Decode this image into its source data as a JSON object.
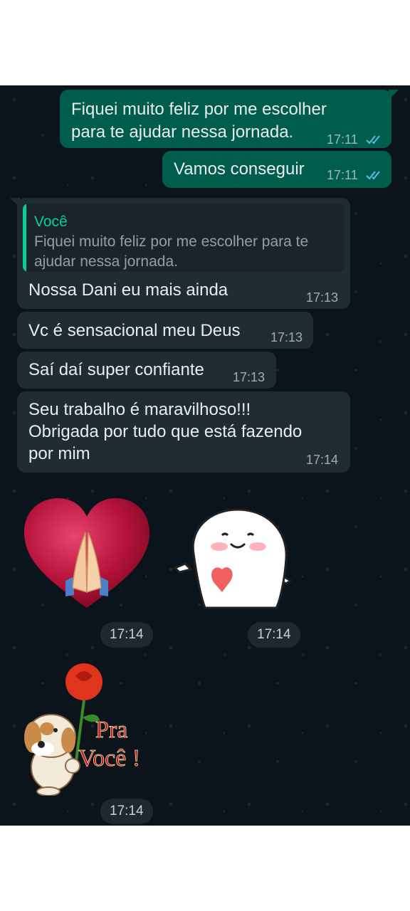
{
  "messages": [
    {
      "text_lines": [
        "Fiquei muito feliz por me escolher",
        "para te ajudar nessa jornada."
      ],
      "time": "17:11"
    },
    {
      "text": "Vamos conseguir",
      "time": "17:11"
    },
    {
      "quote_author": "Você",
      "quote_text": "Fiquei muito feliz por me escolher para te ajudar nessa jornada.",
      "text": "Nossa Dani eu mais ainda",
      "time": "17:13"
    },
    {
      "text": "Vc é sensacional meu Deus",
      "time": "17:13"
    },
    {
      "text": "Saí daí super confiante",
      "time": "17:13"
    },
    {
      "text_lines": [
        "Seu trabalho é maravilhoso!!!",
        "Obrigada por tudo que está fazendo",
        "por mim"
      ],
      "time": "17:14"
    }
  ],
  "stickers": [
    {
      "icon": "heart-praying-hands-icon",
      "time": "17:14"
    },
    {
      "icon": "cute-blob-holding-heart-icon",
      "time": "17:14"
    },
    {
      "icon": "puppy-with-rose-icon",
      "caption_line1": "Pra",
      "caption_line2": "Você !",
      "time": "17:14"
    }
  ],
  "colors": {
    "chat_background": "#0b141a",
    "outgoing_bubble": "#005c4b",
    "incoming_bubble": "#202c33",
    "read_ticks": "#53bdeb",
    "quote_accent": "#06cf9c"
  }
}
